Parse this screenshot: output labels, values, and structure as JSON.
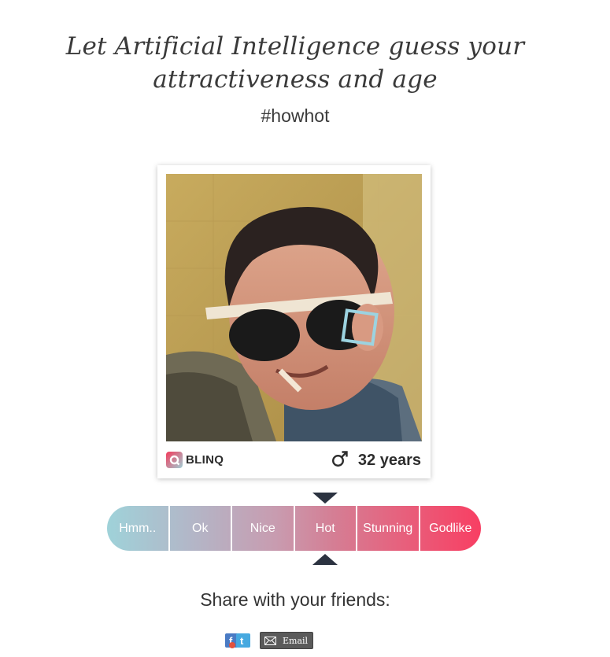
{
  "header": {
    "title_line1": "Let Artificial Intelligence guess your",
    "title_line2": "attractiveness and age",
    "hashtag": "#howhot"
  },
  "result_card": {
    "brand": "BLINQ",
    "gender_icon": "male-symbol-icon",
    "age_text": "32 years"
  },
  "rating_scale": {
    "labels": [
      "Hmm..",
      "Ok",
      "Nice",
      "Hot",
      "Stunning",
      "Godlike"
    ],
    "selected": "Hot",
    "gradient_start": "#9fd2d9",
    "gradient_end": "#f83f63",
    "pointer_color": "#2c3341"
  },
  "share": {
    "title": "Share with your friends:",
    "social_icon": "facebook-twitter-share-icon",
    "email_label": "Email"
  },
  "colors": {
    "face_box": "#9cd3e0",
    "text": "#333333"
  }
}
